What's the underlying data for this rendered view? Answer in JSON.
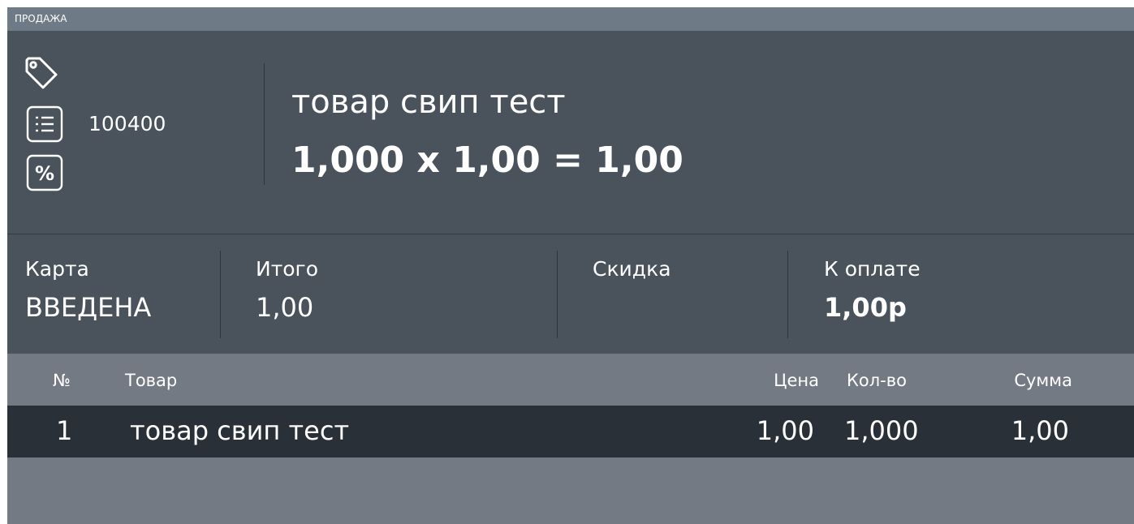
{
  "mode": {
    "title": "ПРОДАЖА"
  },
  "top": {
    "icons": [
      "tag-icon",
      "list-icon",
      "percent-icon"
    ],
    "code": "100400",
    "product_name": "товар свип тест",
    "calculation": "1,000 x 1,00 = 1,00"
  },
  "summary": {
    "card": {
      "label": "Карта",
      "value": "ВВЕДЕНА"
    },
    "total": {
      "label": "Итого",
      "value": "1,00"
    },
    "discount": {
      "label": "Скидка",
      "value": ""
    },
    "to_pay": {
      "label": "К оплате",
      "value": "1,00р"
    }
  },
  "table": {
    "headers": {
      "num": "№",
      "product": "Товар",
      "price": "Цена",
      "qty": "Кол-во",
      "sum": "Сумма"
    },
    "rows": [
      {
        "num": "1",
        "product": "товар свип тест",
        "price": "1,00",
        "qty": "1,000",
        "sum": "1,00"
      }
    ]
  },
  "colors": {
    "panel": "#4a535c",
    "mode_bar": "#6e7a86",
    "table_bg": "#737a84",
    "selected_row": "#2a3037",
    "text": "#ffffff"
  }
}
